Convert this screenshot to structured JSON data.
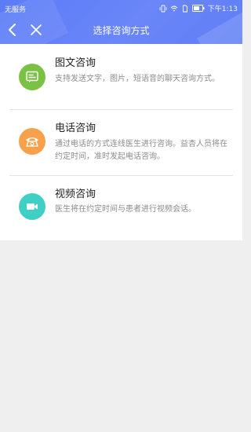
{
  "status_bar": {
    "carrier": "无服务",
    "time": "下午1:13"
  },
  "nav": {
    "title": "选择咨询方式"
  },
  "options": [
    {
      "title": "图文咨询",
      "desc": "支持发送文字，图片，短语音的聊天咨询方式。",
      "icon": "chat-icon",
      "color": "#7bc144"
    },
    {
      "title": "电话咨询",
      "desc": "通过电话的方式连线医生进行咨询。益杏人员将在约定时间，准时发起电话咨询。",
      "icon": "phone-icon",
      "color": "#f7a24b"
    },
    {
      "title": "视频咨询",
      "desc": "医生将在约定时间与患者进行视频会话。",
      "icon": "video-icon",
      "color": "#3fcfc4"
    }
  ],
  "colors": {
    "header": "#5b7cf7",
    "background": "#efefef"
  }
}
